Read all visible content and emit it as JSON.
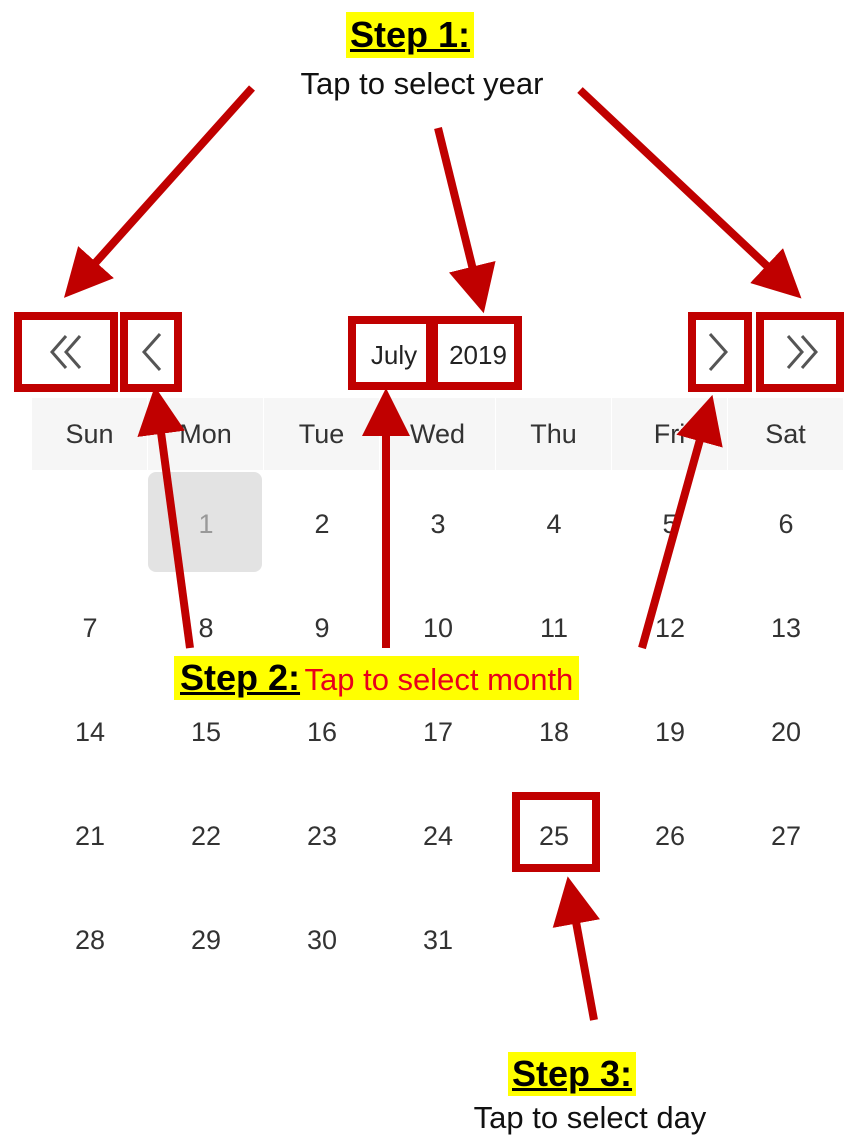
{
  "annotations": {
    "step1": {
      "title": "Step 1:",
      "text": "Tap to select year"
    },
    "step2": {
      "title": "Step 2:",
      "text": "Tap to select month"
    },
    "step3": {
      "title": "Step 3:",
      "text": "Tap to select day"
    }
  },
  "calendar": {
    "month": "July",
    "year": "2019",
    "weekdays": [
      "Sun",
      "Mon",
      "Tue",
      "Wed",
      "Thu",
      "Fri",
      "Sat"
    ],
    "first_weekday_index": 1,
    "days": [
      "1",
      "2",
      "3",
      "4",
      "5",
      "6",
      "7",
      "8",
      "9",
      "10",
      "11",
      "12",
      "13",
      "14",
      "15",
      "16",
      "17",
      "18",
      "19",
      "20",
      "21",
      "22",
      "23",
      "24",
      "25",
      "26",
      "27",
      "28",
      "29",
      "30",
      "31"
    ],
    "today": "1",
    "highlighted_day": "25",
    "nav_icons": {
      "prev_year": "double-chevron-left-icon",
      "prev_month": "chevron-left-icon",
      "next_month": "chevron-right-icon",
      "next_year": "double-chevron-right-icon"
    }
  },
  "colors": {
    "annotation_red": "#c00000",
    "highlight_yellow": "#ffff00",
    "today_background": "#e3e3e3",
    "weekday_header_background": "#f6f6f6"
  }
}
